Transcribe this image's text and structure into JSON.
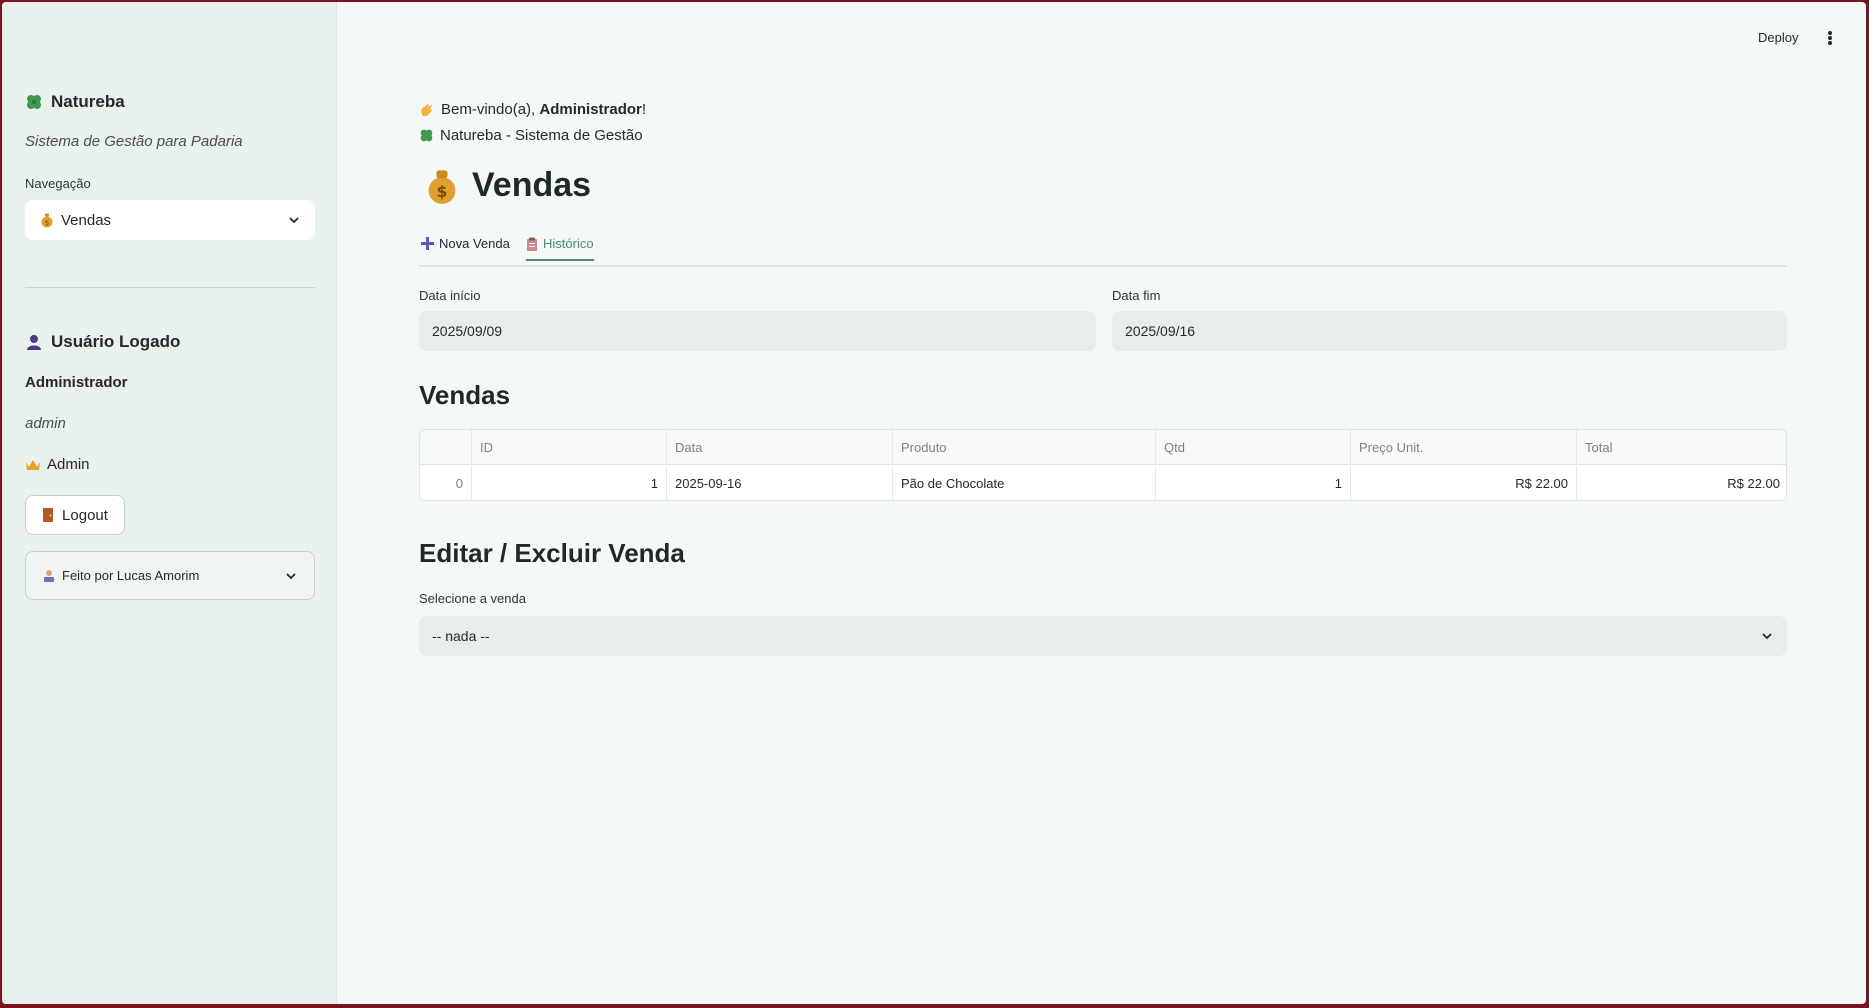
{
  "sidebar": {
    "brand": "Natureba",
    "subtitle": "Sistema de Gestão para Padaria",
    "nav_label": "Navegação",
    "nav_selected": "Vendas",
    "user_section_title": "Usuário Logado",
    "user_name": "Administrador",
    "user_login": "admin",
    "user_role": "Admin",
    "logout_label": "Logout",
    "credits_label": "Feito por Lucas Amorim"
  },
  "toolbar": {
    "deploy_label": "Deploy"
  },
  "main": {
    "welcome_prefix": "Bem-vindo(a), ",
    "welcome_name": "Administrador",
    "welcome_suffix": "!",
    "app_line": "Natureba - Sistema de Gestão",
    "page_title": "Vendas",
    "tabs": [
      {
        "label": "Nova Venda",
        "active": false
      },
      {
        "label": "Histórico",
        "active": true
      }
    ],
    "date_start_label": "Data início",
    "date_start_value": "2025/09/09",
    "date_end_label": "Data fim",
    "date_end_value": "2025/09/16",
    "sales_title": "Vendas",
    "table": {
      "columns": [
        "",
        "ID",
        "Data",
        "Produto",
        "Qtd",
        "Preço Unit.",
        "Total"
      ],
      "rows": [
        [
          "0",
          "1",
          "2025-09-16",
          "Pão de Chocolate",
          "1",
          "R$ 22.00",
          "R$ 22.00"
        ]
      ]
    },
    "edit_title": "Editar / Excluir Venda",
    "select_label": "Selecione a venda",
    "select_value": "-- nada --"
  },
  "colors": {
    "sidebar_bg": "#e8f1ec",
    "main_bg": "#f4f8f6",
    "accent": "#4f8a6b",
    "window_border": "#7a1420"
  }
}
